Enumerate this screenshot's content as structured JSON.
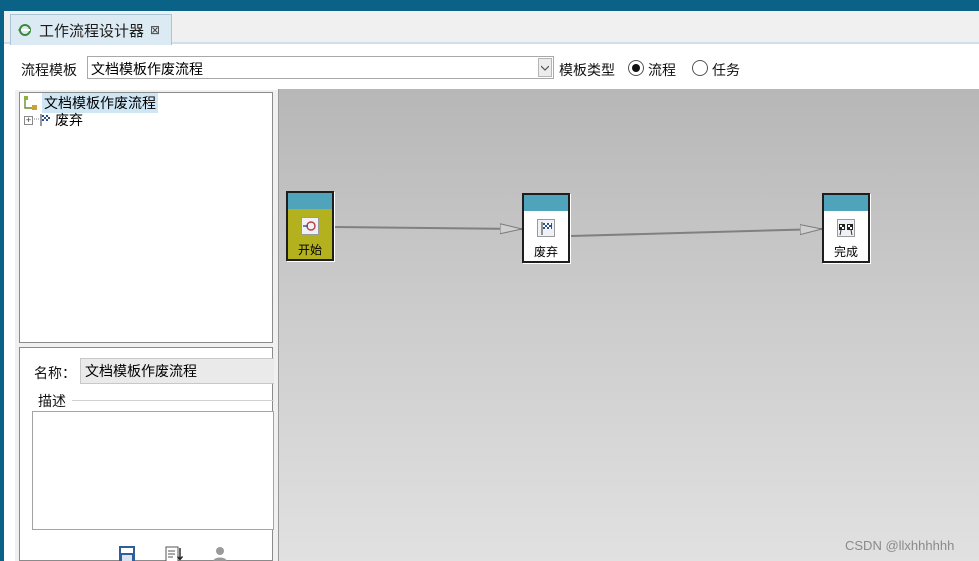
{
  "tab": {
    "title": "工作流程设计器",
    "icon": "workflow-icon",
    "close_icon": "close-icon"
  },
  "toolbar": {
    "template_label": "流程模板",
    "template_value": "文档模板作废流程",
    "type_label": "模板类型",
    "radio_options": [
      {
        "label": "流程",
        "selected": true
      },
      {
        "label": "任务",
        "selected": false
      }
    ]
  },
  "tree": {
    "root": {
      "label": "文档模板作废流程",
      "icon": "flow-root-icon"
    },
    "children": [
      {
        "label": "废弃",
        "icon": "flag-icon",
        "expander": "⊞"
      }
    ]
  },
  "props": {
    "name_label": "名称：",
    "name_value": "文档模板作废流程",
    "desc_label": "描述",
    "desc_value": "",
    "buttons": [
      "save-icon",
      "import-icon",
      "user-icon"
    ]
  },
  "canvas": {
    "nodes": [
      {
        "label": "开始",
        "type": "start",
        "icon": "start-icon",
        "color": "#b3b21e"
      },
      {
        "label": "废弃",
        "type": "task",
        "icon": "flag-icon"
      },
      {
        "label": "完成",
        "type": "end",
        "icon": "checkered-flag-icon"
      }
    ],
    "header_color": "#4fa3bb"
  },
  "watermark": "CSDN @llxhhhhhh"
}
